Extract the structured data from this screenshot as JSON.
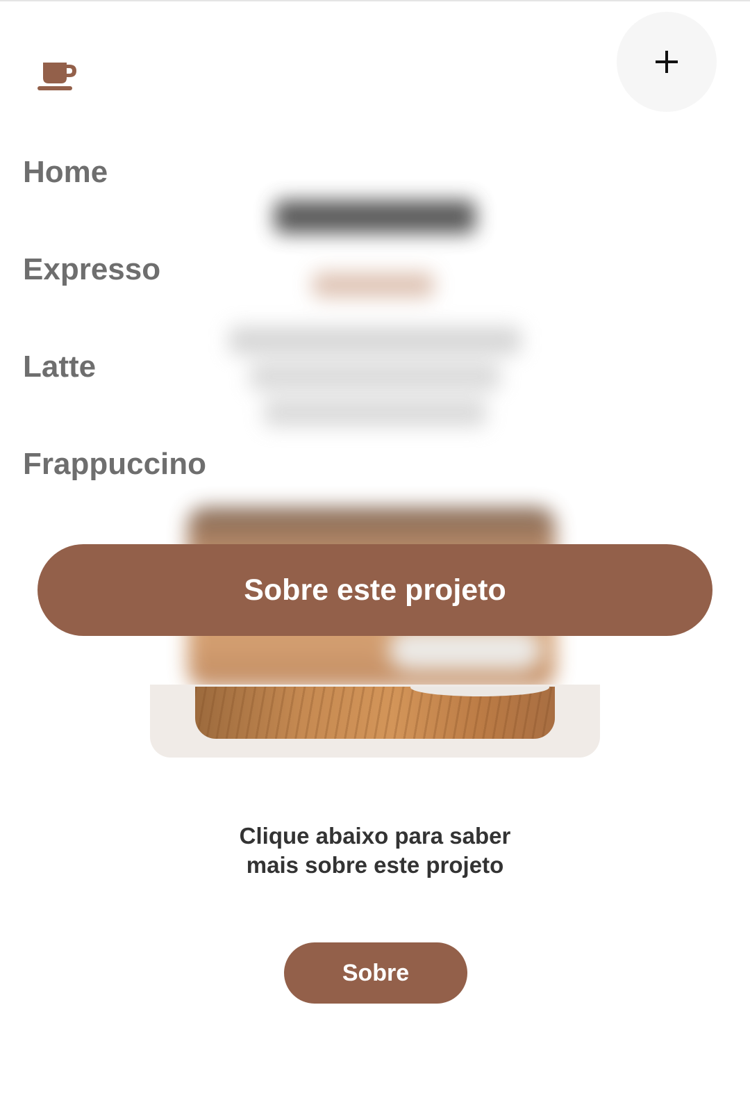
{
  "menu": {
    "close_icon": "plus-icon",
    "logo_icon": "coffee-cup-icon",
    "items": [
      {
        "label": "Home"
      },
      {
        "label": "Expresso"
      },
      {
        "label": "Latte"
      },
      {
        "label": "Frappuccino"
      }
    ],
    "about_button_label": "Sobre este projeto"
  },
  "page": {
    "cta_line1": "Clique abaixo para saber",
    "cta_line2": "mais sobre este projeto",
    "about_button_label": "Sobre"
  },
  "colors": {
    "accent": "#93604a",
    "nav_text": "#6e6e6e",
    "card_bg": "#f0ebe7"
  }
}
